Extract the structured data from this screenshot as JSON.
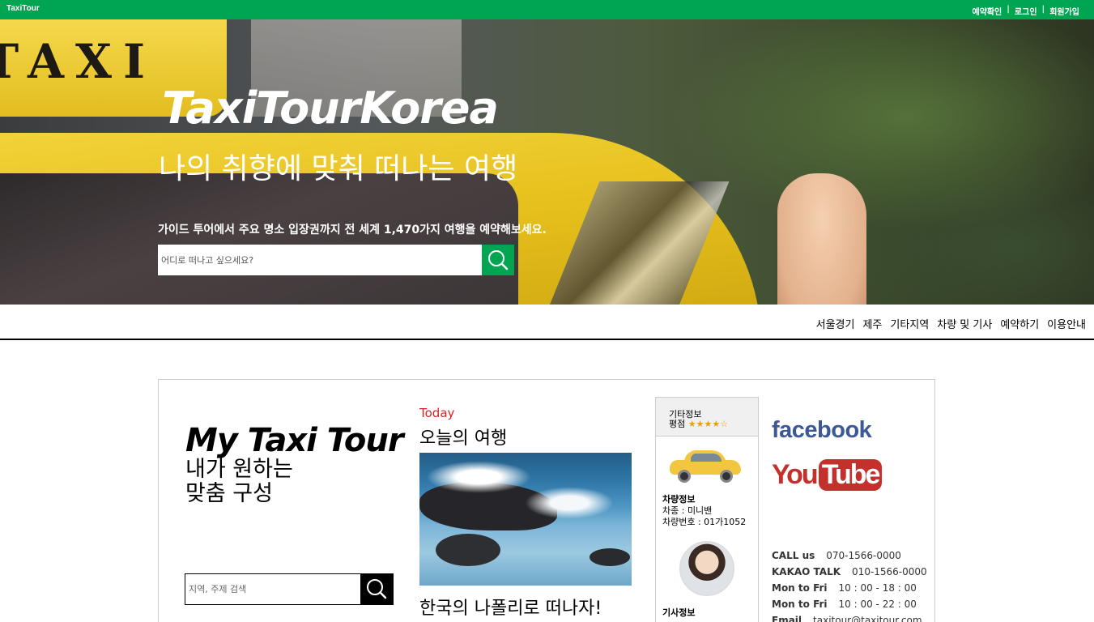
{
  "topbar": {
    "brand": "TaxiTour",
    "links": [
      "예약확인",
      "로그인",
      "회원가입"
    ],
    "separator": "|"
  },
  "hero": {
    "taxi_sign": "TAXI",
    "title": "TaxiTourKorea",
    "subtitle": "나의 취향에 맞춰 떠나는 여행",
    "description": "가이드 투어에서 주요 명소 입장권까지 전 세계 1,470가지 여행을 예약해보세요.",
    "search_placeholder": "어디로 떠나고 싶으세요?",
    "accent_color": "#00a551"
  },
  "nav": {
    "items": [
      "서울경기",
      "제주",
      "기타지역",
      "차량 및 기사",
      "예약하기",
      "이용안내"
    ]
  },
  "my_tour": {
    "title": "My Taxi Tour",
    "subtitle_line1": "내가 원하는",
    "subtitle_line2": "맞춤 구성",
    "search_placeholder": "지역, 주제 검색"
  },
  "today": {
    "label": "Today",
    "title": "오늘의 여행",
    "caption": "한국의 나폴리로 떠나자!"
  },
  "info": {
    "header": "기타정보",
    "rating_label": "평점",
    "rating_stars": "★★★★☆",
    "vehicle_title": "차량정보",
    "vehicle_type": "차종 : 미니밴",
    "vehicle_number": "차량번호 : 01가1052",
    "driver_title": "기사정보"
  },
  "social": {
    "facebook": "facebook",
    "youtube_you": "You",
    "youtube_tube": "Tube"
  },
  "contact": [
    {
      "label": "CALL us",
      "value": "070-1566-0000"
    },
    {
      "label": "KAKAO TALK",
      "value": "010-1566-0000"
    },
    {
      "label": "Mon to Fri",
      "value": "10 : 00 - 18 : 00"
    },
    {
      "label": "Mon to Fri",
      "value": "10 : 00 - 22 : 00"
    },
    {
      "label": "Email",
      "value": "taxitour@taxitour.com"
    }
  ]
}
